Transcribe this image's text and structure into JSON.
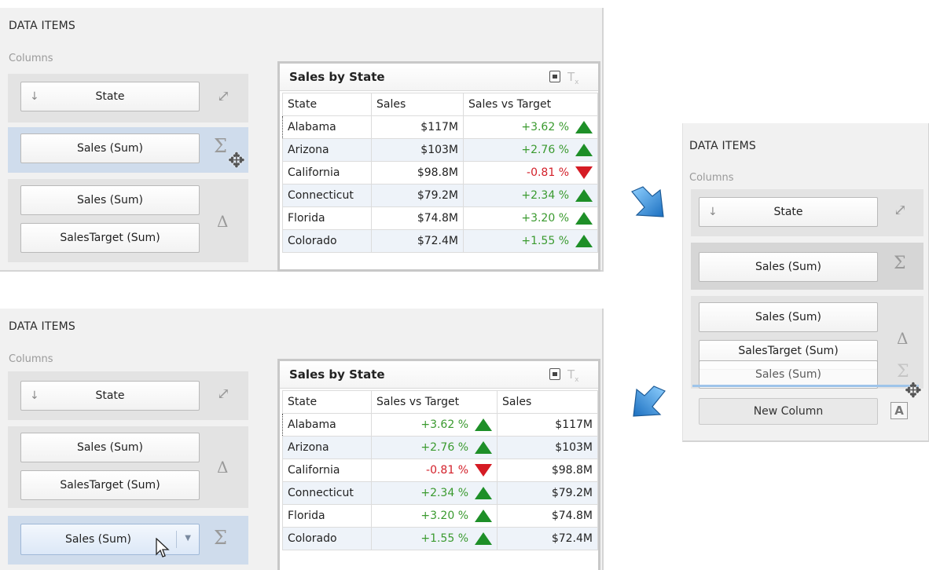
{
  "panel_title": "DATA ITEMS",
  "section_label": "Columns",
  "cards": {
    "state": "State",
    "sales_sum": "Sales (Sum)",
    "sales_target_sum": "SalesTarget (Sum)",
    "new_column": "New Column"
  },
  "grid": {
    "title": "Sales by State",
    "headers_a": [
      "State",
      "Sales",
      "Sales vs Target"
    ],
    "headers_b": [
      "State",
      "Sales vs Target",
      "Sales"
    ],
    "rows": [
      {
        "state": "Alabama",
        "sales": "$117M",
        "delta": "+3.62 %",
        "dir": "up"
      },
      {
        "state": "Arizona",
        "sales": "$103M",
        "delta": "+2.76 %",
        "dir": "up"
      },
      {
        "state": "California",
        "sales": "$98.8M",
        "delta": "-0.81 %",
        "dir": "down"
      },
      {
        "state": "Connecticut",
        "sales": "$79.2M",
        "delta": "+2.34 %",
        "dir": "up"
      },
      {
        "state": "Florida",
        "sales": "$74.8M",
        "delta": "+3.20 %",
        "dir": "up"
      },
      {
        "state": "Colorado",
        "sales": "$72.4M",
        "delta": "+1.55 %",
        "dir": "up"
      }
    ]
  },
  "icons": {
    "sigma": "Σ",
    "delta": "Δ",
    "sort": "↓",
    "dimension": "⤢"
  },
  "colors": {
    "positive": "#3a9a2f",
    "negative": "#d3202a",
    "selected_group": "#cfdcec",
    "arrow_blue": "#2f8fdc"
  }
}
